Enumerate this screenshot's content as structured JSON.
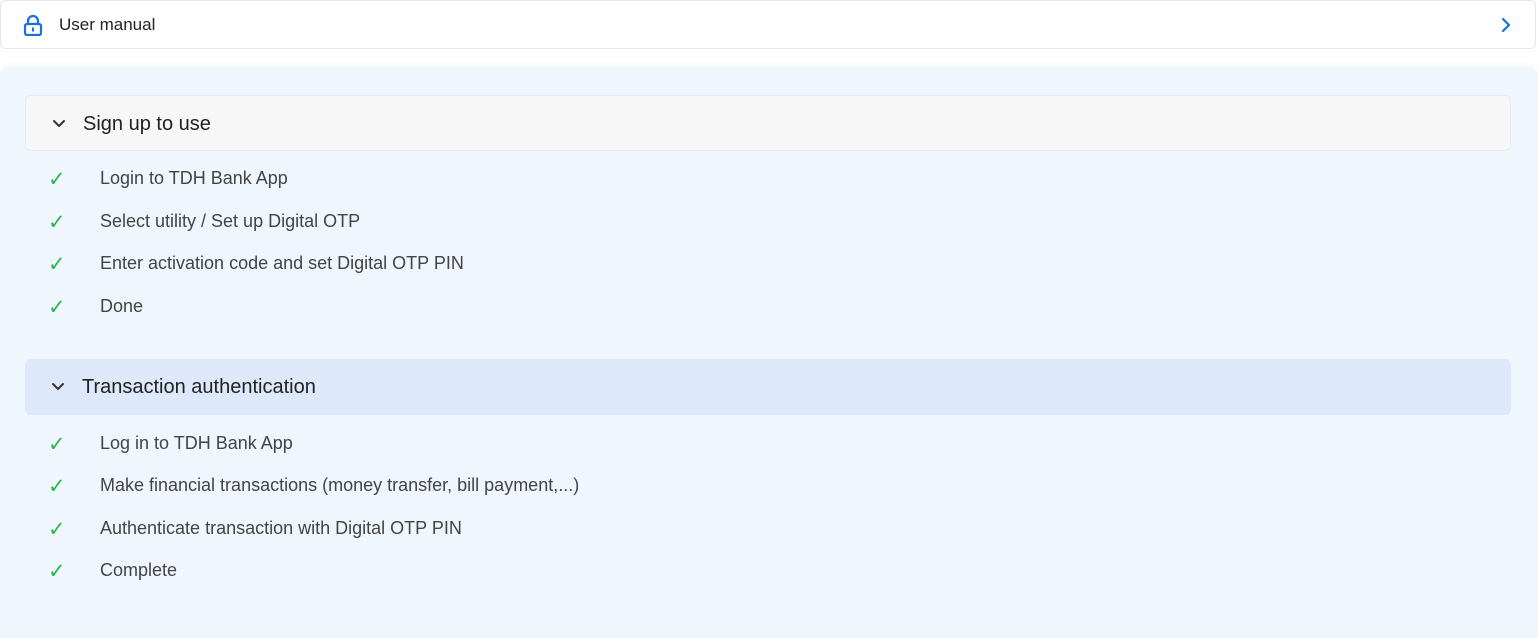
{
  "header": {
    "title": "User manual",
    "lock_icon": "lock-icon",
    "chevron_icon": "chevron-right-icon",
    "accent_color": "#1a6fe0"
  },
  "sections": [
    {
      "title": "Sign up to use",
      "expanded": true,
      "steps": [
        "Login to TDH Bank App",
        "Select utility / Set up Digital OTP",
        "Enter activation code and set Digital OTP PIN",
        "Done"
      ]
    },
    {
      "title": "Transaction authentication",
      "expanded": true,
      "steps": [
        "Log in to TDH Bank App",
        "Make financial transactions (money transfer, bill payment,...)",
        "Authenticate transaction with Digital OTP PIN",
        "Complete"
      ]
    }
  ],
  "check_color": "#2cb650"
}
